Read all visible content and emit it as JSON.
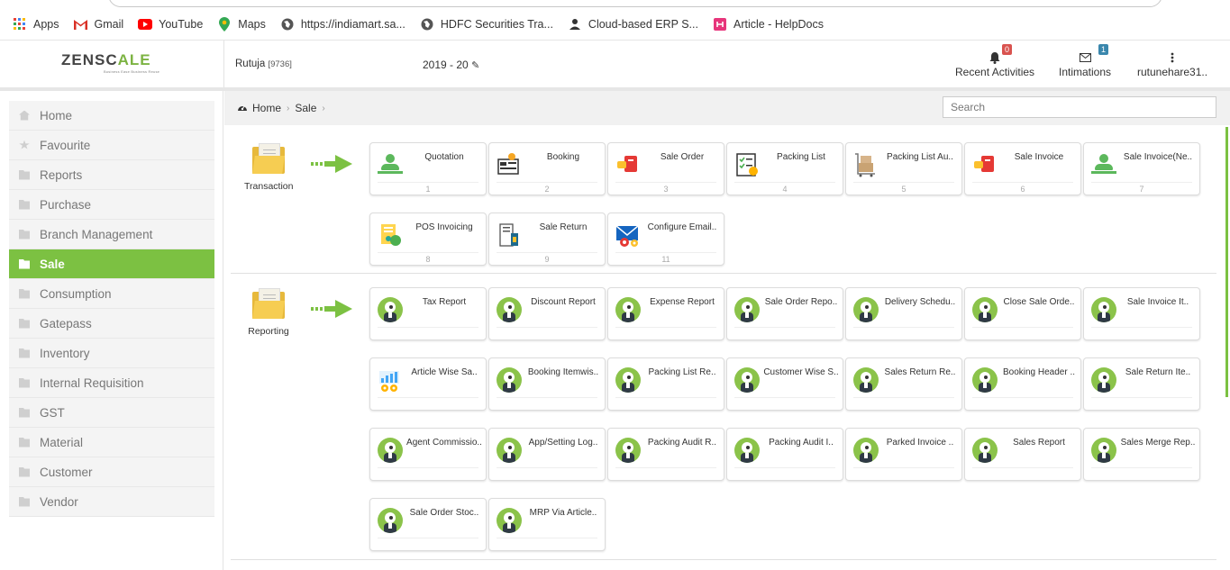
{
  "browser": {
    "bookmarks": [
      {
        "label": "Apps",
        "icon": "apps-grid-icon"
      },
      {
        "label": "Gmail",
        "icon": "gmail-icon"
      },
      {
        "label": "YouTube",
        "icon": "youtube-icon"
      },
      {
        "label": "Maps",
        "icon": "maps-pin-icon"
      },
      {
        "label": "https://indiamart.sa...",
        "icon": "globe-icon"
      },
      {
        "label": "HDFC Securities Tra...",
        "icon": "globe-icon"
      },
      {
        "label": "Cloud-based ERP S...",
        "icon": "erp-icon"
      },
      {
        "label": "Article - HelpDocs",
        "icon": "helpdocs-icon"
      }
    ]
  },
  "header": {
    "logo_text_1": "ZENSC",
    "logo_text_2": "ALE",
    "logo_tagline": "Business Ease Business Reuse",
    "user": "Rutuja",
    "user_code": "[9736]",
    "fiscal_year": "2019 - 20",
    "recent_activities": {
      "label": "Recent Activities",
      "count": "0"
    },
    "intimations": {
      "label": "Intimations",
      "count": "1"
    },
    "account": "rutunehare31..",
    "colors": {
      "accent": "#7cc142",
      "badge_red": "#d9534f",
      "badge_blue": "#3a87ad"
    }
  },
  "sidebar": {
    "items": [
      {
        "label": "Home",
        "icon": "home-icon",
        "active": false
      },
      {
        "label": "Favourite",
        "icon": "star-icon",
        "active": false
      },
      {
        "label": "Reports",
        "icon": "folder-icon",
        "active": false
      },
      {
        "label": "Purchase",
        "icon": "folder-icon",
        "active": false
      },
      {
        "label": "Branch Management",
        "icon": "folder-icon",
        "active": false
      },
      {
        "label": "Sale",
        "icon": "folder-icon",
        "active": true
      },
      {
        "label": "Consumption",
        "icon": "folder-icon",
        "active": false
      },
      {
        "label": "Gatepass",
        "icon": "folder-icon",
        "active": false
      },
      {
        "label": "Inventory",
        "icon": "folder-icon",
        "active": false
      },
      {
        "label": "Internal Requisition",
        "icon": "folder-icon",
        "active": false
      },
      {
        "label": "GST",
        "icon": "folder-icon",
        "active": false
      },
      {
        "label": "Material",
        "icon": "folder-icon",
        "active": false
      },
      {
        "label": "Customer",
        "icon": "folder-icon",
        "active": false
      },
      {
        "label": "Vendor",
        "icon": "folder-icon",
        "active": false
      }
    ]
  },
  "breadcrumb": {
    "home": "Home",
    "current": "Sale"
  },
  "search": {
    "placeholder": "Search"
  },
  "transaction": {
    "label": "Transaction",
    "tiles": [
      {
        "label": "Quotation",
        "num": "1",
        "icon": "person-icon"
      },
      {
        "label": "Booking",
        "num": "2",
        "icon": "booking-icon"
      },
      {
        "label": "Sale Order",
        "num": "3",
        "icon": "sale-order-icon"
      },
      {
        "label": "Packing List",
        "num": "4",
        "icon": "packing-list-icon"
      },
      {
        "label": "Packing List Au..",
        "num": "5",
        "icon": "trolley-icon"
      },
      {
        "label": "Sale Invoice",
        "num": "6",
        "icon": "sale-order-icon"
      },
      {
        "label": "Sale Invoice(Ne..",
        "num": "7",
        "icon": "person-icon"
      },
      {
        "label": "POS Invoicing",
        "num": "8",
        "icon": "pos-icon"
      },
      {
        "label": "Sale Return",
        "num": "9",
        "icon": "sale-return-icon"
      },
      {
        "label": "Configure Email..",
        "num": "11",
        "icon": "email-config-icon"
      }
    ]
  },
  "reporting": {
    "label": "Reporting",
    "tiles": [
      {
        "label": "Tax Report",
        "icon": "report-avatar-icon"
      },
      {
        "label": "Discount Report",
        "icon": "report-avatar-icon"
      },
      {
        "label": "Expense Report",
        "icon": "report-avatar-icon"
      },
      {
        "label": "Sale Order Repo..",
        "icon": "report-avatar-icon"
      },
      {
        "label": "Delivery Schedu..",
        "icon": "report-avatar-icon"
      },
      {
        "label": "Close Sale Orde..",
        "icon": "report-avatar-icon"
      },
      {
        "label": "Sale Invoice It..",
        "icon": "report-avatar-icon"
      },
      {
        "label": "Article Wise Sa..",
        "icon": "analytics-icon"
      },
      {
        "label": "Booking Itemwis..",
        "icon": "report-avatar-icon"
      },
      {
        "label": "Packing List Re..",
        "icon": "report-avatar-icon"
      },
      {
        "label": "Customer Wise S..",
        "icon": "report-avatar-icon"
      },
      {
        "label": "Sales Return Re..",
        "icon": "report-avatar-icon"
      },
      {
        "label": "Booking Header ..",
        "icon": "report-avatar-icon"
      },
      {
        "label": "Sale Return Ite..",
        "icon": "report-avatar-icon"
      },
      {
        "label": "Agent Commissio..",
        "icon": "report-avatar-icon"
      },
      {
        "label": "App/Setting Log..",
        "icon": "report-avatar-icon"
      },
      {
        "label": "Packing Audit R..",
        "icon": "report-avatar-icon"
      },
      {
        "label": "Packing Audit I..",
        "icon": "report-avatar-icon"
      },
      {
        "label": "Parked Invoice ..",
        "icon": "report-avatar-icon"
      },
      {
        "label": "Sales Report",
        "icon": "report-avatar-icon"
      },
      {
        "label": "Sales Merge Rep..",
        "icon": "report-avatar-icon"
      },
      {
        "label": "Sale Order Stoc..",
        "icon": "report-avatar-icon"
      },
      {
        "label": "MRP Via Article..",
        "icon": "report-avatar-icon"
      }
    ]
  }
}
